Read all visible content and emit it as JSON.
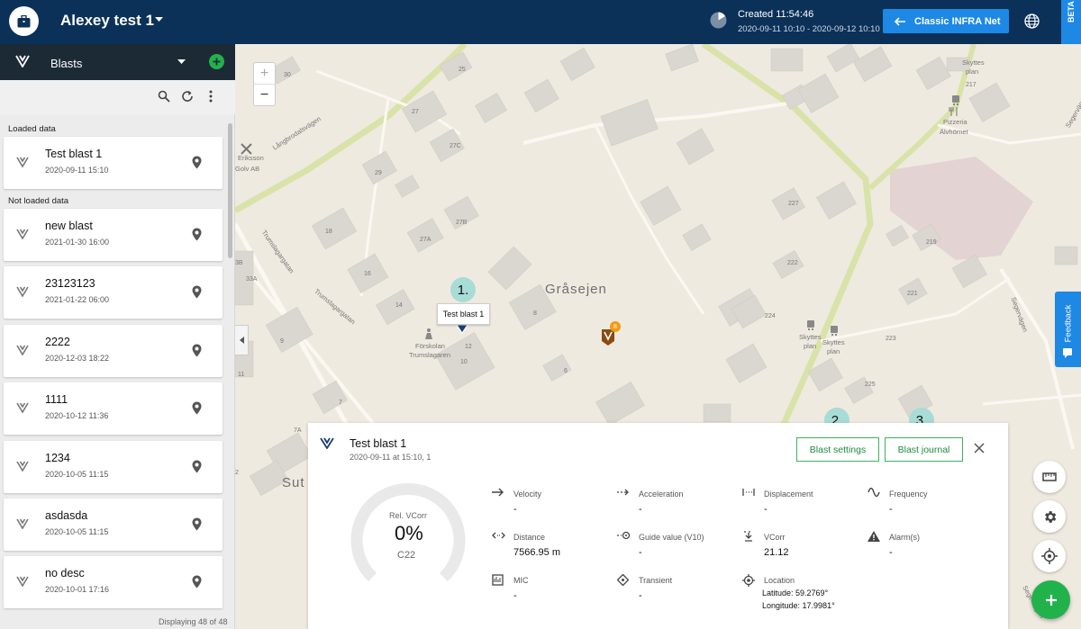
{
  "header": {
    "title": "Alexey test 1",
    "created": "Created 11:54:46",
    "created_range": "2020-09-11 10:10 - 2020-09-12 10:10",
    "classic_button": "Classic INFRA Net",
    "beta": "BETA"
  },
  "left_panel": {
    "title": "Blasts",
    "loaded_label": "Loaded data",
    "not_loaded_label": "Not loaded data",
    "loaded": [
      {
        "name": "Test blast 1",
        "date": "2020-09-11 15:10"
      }
    ],
    "not_loaded": [
      {
        "name": "new blast",
        "date": "2021-01-30 16:00"
      },
      {
        "name": "23123123",
        "date": "2021-01-22 06:00"
      },
      {
        "name": "2222",
        "date": "2020-12-03 18:22"
      },
      {
        "name": "1111",
        "date": "2020-10-12 11:36"
      },
      {
        "name": "1234",
        "date": "2020-10-05 11:15"
      },
      {
        "name": "asdasda",
        "date": "2020-10-05 11:15"
      },
      {
        "name": "no desc",
        "date": "2020-10-01 17:16"
      }
    ],
    "displaying": "Displaying 48 of 48"
  },
  "map": {
    "zoom_in": "+",
    "zoom_out": "−",
    "place_grasejen": "Gråsejen",
    "place_sut": "Sut",
    "tooltip": "Test blast 1",
    "bubble_1": "1.",
    "bubble_2": "2.",
    "bubble_3": "3.",
    "feedback": "Feedback",
    "marker_badge": "8",
    "labels": {
      "eriksson": "Eriksson",
      "golv": "Golv AB",
      "skyttes_plan_top": "Skyttes",
      "skyttes_plan_top2": "plan",
      "pizzeria": "Pizzeria",
      "alvhornet": "Älvhörnet",
      "forskolan": "Förskolan",
      "trumslagaren": "Trumslagaren",
      "skyttes_plan_a": "Skyttes",
      "skyttes_plan_a2": "plan",
      "skyttes_plan_b": "Skyttes",
      "skyttes_plan_b2": "plan",
      "langbrodalsvagen": "Långbrodalsvägen",
      "trumslagargatan1": "Trumslagargatan",
      "trumslagargatan2": "Trumslagargatan",
      "segervagen": "Segervägen",
      "segervagen2": "Segervägen",
      "segervagen3": "Segervägen",
      "house_numbers": [
        "30",
        "25",
        "27",
        "27C",
        "29",
        "27B",
        "18",
        "27A",
        "16",
        "14",
        "3B",
        "33A",
        "9",
        "11",
        "7",
        "7A",
        "12",
        "8",
        "6",
        "10",
        "2",
        "227",
        "222",
        "219",
        "221",
        "224",
        "223",
        "225",
        "217"
      ]
    }
  },
  "detail": {
    "title": "Test blast 1",
    "subtitle": "2020-09-11 at 15:10, 1",
    "blast_settings": "Blast settings",
    "blast_journal": "Blast journal",
    "gauge_label": "Rel. VCorr",
    "gauge_value": "0%",
    "gauge_code": "C22",
    "gauge_fraction": 0,
    "metrics": {
      "velocity": {
        "label": "Velocity",
        "value": "-"
      },
      "acceleration": {
        "label": "Acceleration",
        "value": "-"
      },
      "displacement": {
        "label": "Displacement",
        "value": "-"
      },
      "frequency": {
        "label": "Frequency",
        "value": "-"
      },
      "distance": {
        "label": "Distance",
        "value": "7566.95 m"
      },
      "guide_value": {
        "label": "Guide value (V10)",
        "value": "-"
      },
      "vcorr": {
        "label": "VCorr",
        "value": "21.12"
      },
      "alarms": {
        "label": "Alarm(s)",
        "value": "-"
      },
      "mic": {
        "label": "MIC",
        "value": "-"
      },
      "transient": {
        "label": "Transient",
        "value": "-"
      },
      "location": {
        "label": "Location",
        "latitude": "Latitude: 59.2769°",
        "longitude": "Longitude: 17.9981°"
      }
    }
  },
  "colors": {
    "header_bg": "#0b3158",
    "accent_blue": "#1e88e5",
    "green": "#22b24c",
    "panel_dark": "#1c2a36"
  }
}
